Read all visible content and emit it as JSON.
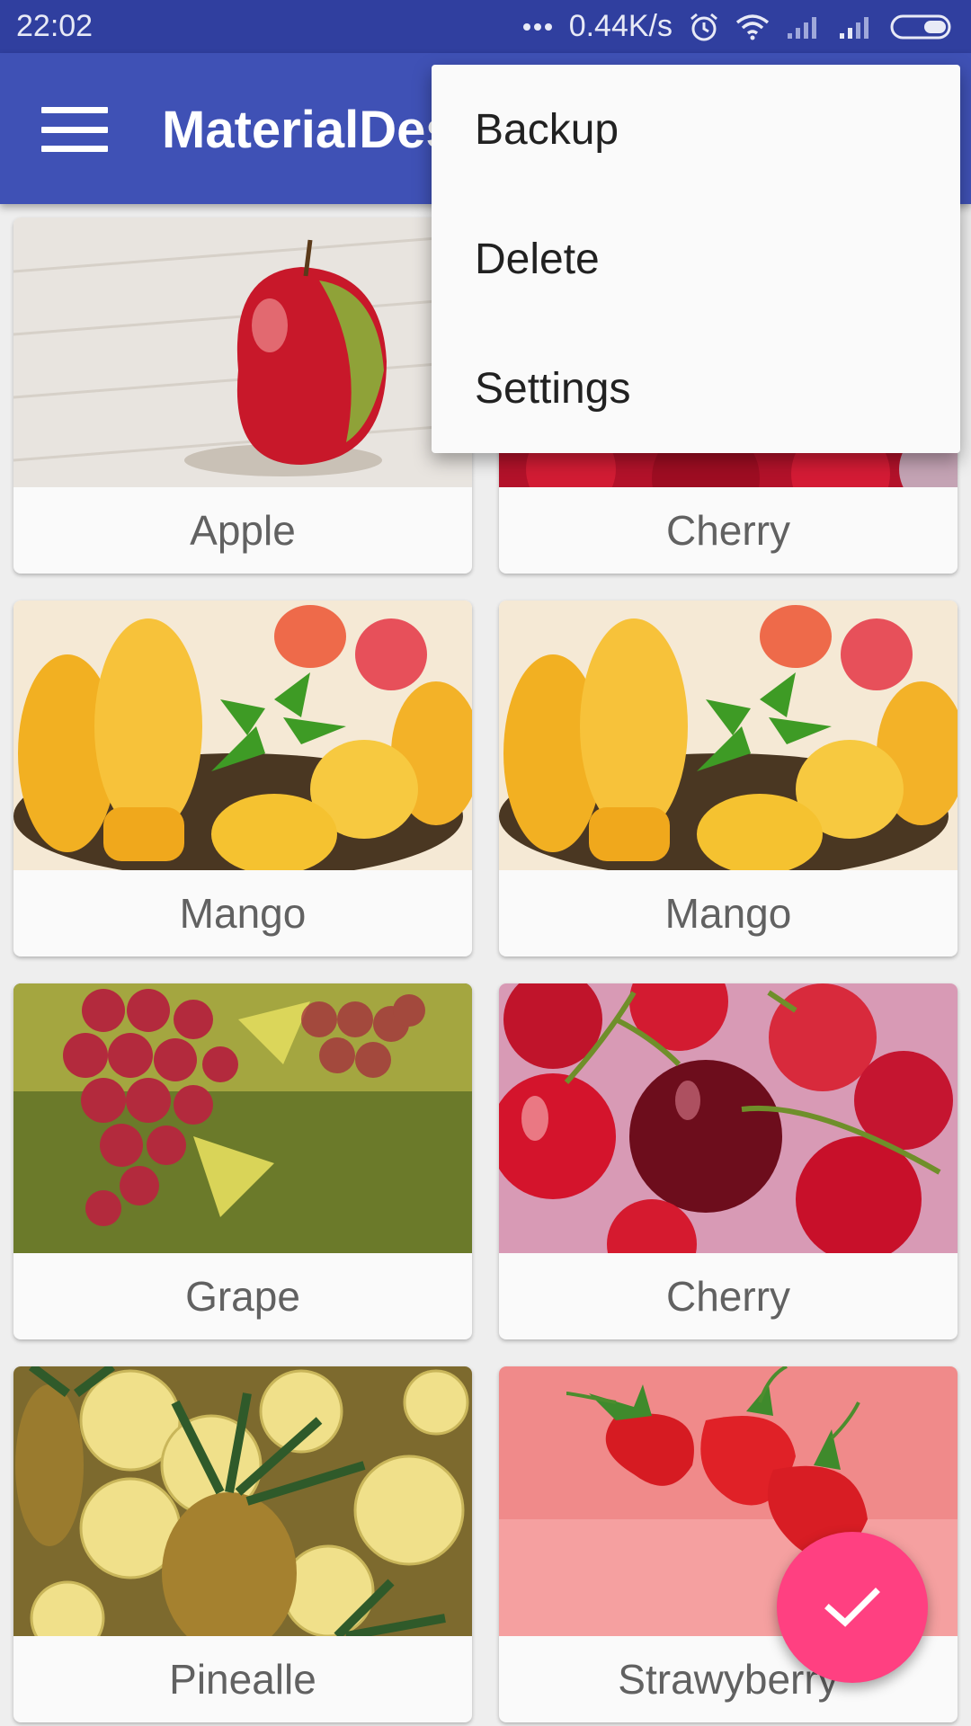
{
  "status_bar": {
    "time": "22:02",
    "network_speed": "0.44K/s",
    "icons": [
      "more-dots-icon",
      "alarm-icon",
      "wifi-icon",
      "signal-icon",
      "signal-icon",
      "battery-icon"
    ]
  },
  "toolbar": {
    "title": "MaterialDesignDemo",
    "menu_icon": "hamburger-menu-icon"
  },
  "overflow_menu": {
    "items": [
      "Backup",
      "Delete",
      "Settings"
    ]
  },
  "cards": [
    {
      "label": "Apple",
      "image": "apple-photo"
    },
    {
      "label": "Cherry",
      "image": "cherry-photo"
    },
    {
      "label": "Mango",
      "image": "mango-photo"
    },
    {
      "label": "Mango",
      "image": "mango-photo"
    },
    {
      "label": "Grape",
      "image": "grape-photo"
    },
    {
      "label": "Cherry",
      "image": "cherry-photo"
    },
    {
      "label": "Pinealle",
      "image": "pineapple-photo"
    },
    {
      "label": "Strawyberry",
      "image": "strawberry-photo"
    }
  ],
  "fab": {
    "icon": "check-icon"
  },
  "colors": {
    "status_bar": "#303f9f",
    "primary": "#3f51b5",
    "accent": "#ff4081",
    "card_background": "#fafafa",
    "label_text": "#616161"
  }
}
